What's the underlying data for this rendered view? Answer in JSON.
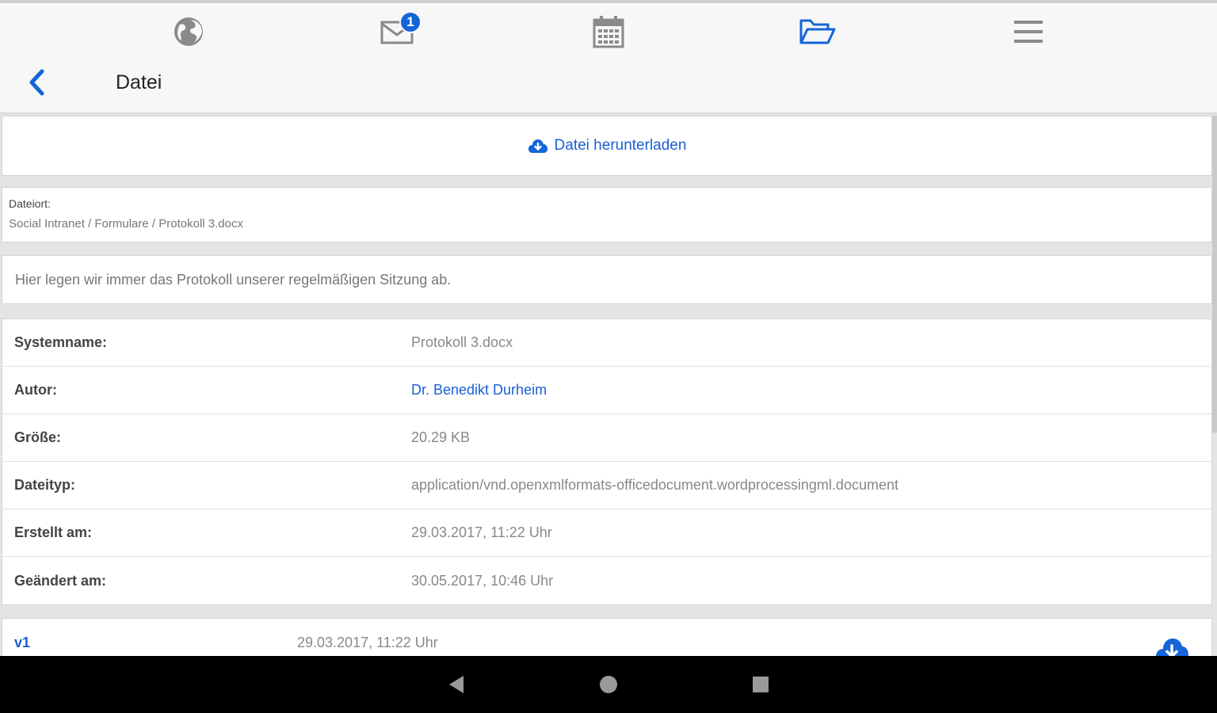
{
  "header": {
    "title": "Datei",
    "tabs": [
      {
        "icon": "globe-icon"
      },
      {
        "icon": "mail-icon",
        "badge": "1"
      },
      {
        "icon": "calendar-icon"
      },
      {
        "icon": "folder-open-icon",
        "active": true
      },
      {
        "icon": "menu-icon"
      }
    ],
    "accent_color": "#1565d8"
  },
  "download": {
    "label": "Datei herunterladen",
    "icon": "cloud-download-icon"
  },
  "location": {
    "label": "Dateiort:",
    "path": "Social Intranet / Formulare / Protokoll 3.docx"
  },
  "description": "Hier legen wir immer das Protokoll unserer regelmäßigen Sitzung ab.",
  "details": [
    {
      "label": "Systemname:",
      "value": "Protokoll 3.docx"
    },
    {
      "label": "Autor:",
      "value": "Dr. Benedikt Durheim"
    },
    {
      "label": "Größe:",
      "value": "20.29 KB"
    },
    {
      "label": "Dateityp:",
      "value": "application/vnd.openxmlformats-officedocument.wordprocessingml.document"
    },
    {
      "label": "Erstellt am:",
      "value": "29.03.2017, 11:22 Uhr"
    },
    {
      "label": "Geändert am:",
      "value": "30.05.2017, 10:46 Uhr"
    }
  ],
  "versions": [
    {
      "name": "v1",
      "date": "29.03.2017, 11:22 Uhr"
    }
  ],
  "system_nav": [
    "back-triangle-icon",
    "home-circle-icon",
    "recents-square-icon"
  ]
}
